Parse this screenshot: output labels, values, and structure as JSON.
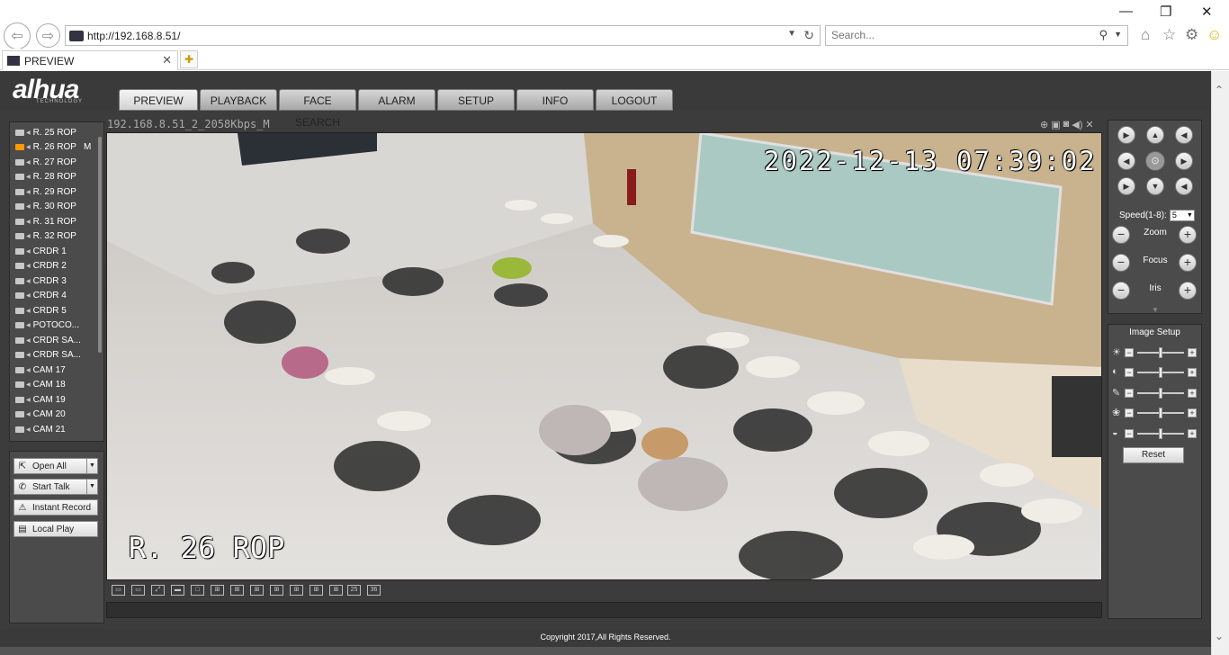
{
  "browser": {
    "url": "http://192.168.8.51/",
    "search_placeholder": "Search...",
    "tab_title": "PREVIEW"
  },
  "app": {
    "logo": "alhua",
    "logo_sub": "TECHNOLOGY",
    "menu": [
      {
        "label": "PREVIEW",
        "active": true
      },
      {
        "label": "PLAYBACK"
      },
      {
        "label": "FACE SEARCH"
      },
      {
        "label": "ALARM"
      },
      {
        "label": "SETUP"
      },
      {
        "label": "INFO"
      },
      {
        "label": "LOGOUT"
      }
    ],
    "cameras": [
      {
        "label": "R. 25 ROP"
      },
      {
        "label": "R. 26 ROP",
        "active": true,
        "flag": "M"
      },
      {
        "label": "R. 27 ROP"
      },
      {
        "label": "R. 28 ROP"
      },
      {
        "label": "R. 29 ROP"
      },
      {
        "label": "R. 30 ROP"
      },
      {
        "label": "R. 31 ROP"
      },
      {
        "label": "R. 32 ROP"
      },
      {
        "label": "CRDR 1"
      },
      {
        "label": "CRDR 2"
      },
      {
        "label": "CRDR 3"
      },
      {
        "label": "CRDR 4"
      },
      {
        "label": "CRDR 5"
      },
      {
        "label": "POTOCO..."
      },
      {
        "label": "CRDR SA..."
      },
      {
        "label": "CRDR SA..."
      },
      {
        "label": "CAM 17"
      },
      {
        "label": "CAM 18"
      },
      {
        "label": "CAM 19"
      },
      {
        "label": "CAM 20"
      },
      {
        "label": "CAM 21"
      }
    ],
    "controls": {
      "open_all": "Open All",
      "start_talk": "Start Talk",
      "instant_record": "Instant Record",
      "local_play": "Local Play"
    },
    "video": {
      "stream_title": "192.168.8.51_2_2058Kbps_M",
      "osd_time": "2022-12-13 07:39:02",
      "osd_name": "R. 26 ROP"
    },
    "layout_labels": [
      "25",
      "36"
    ],
    "ptz": {
      "speed_label": "Speed(1-8):",
      "speed_value": "5",
      "zoom": "Zoom",
      "focus": "Focus",
      "iris": "Iris"
    },
    "image_setup": {
      "title": "Image Setup",
      "reset": "Reset",
      "levels": [
        0.5,
        0.5,
        0.5,
        0.5,
        0.5
      ]
    },
    "footer": "Copyright 2017,All Rights Reserved."
  }
}
